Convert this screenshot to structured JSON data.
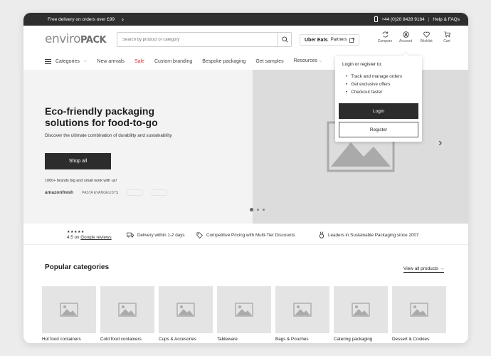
{
  "topbar": {
    "promo": "Free delivery on orders over £99",
    "promo_arrow": "›",
    "phone": "+44 (0)20 8428 9184",
    "separator": "|",
    "help": "Help & FAQs"
  },
  "header": {
    "logo_light": "enviro",
    "logo_bold": "PACK",
    "search_placeholder": "Search by product or category",
    "partner_brand": "Uber Eats",
    "partner_label": "Partners",
    "icons": [
      {
        "name": "compare-icon",
        "label": "Compare"
      },
      {
        "name": "account-icon",
        "label": "Account"
      },
      {
        "name": "wishlist-icon",
        "label": "Wishlist"
      },
      {
        "name": "cart-icon",
        "label": "Cart"
      }
    ]
  },
  "nav": {
    "categories": "Categories",
    "items": [
      "New arrivals",
      "Sale",
      "Custom branding",
      "Bespoke packaging",
      "Get samples",
      "Resources"
    ],
    "chevron": "⌵",
    "sale_color": "#dd3333"
  },
  "hero": {
    "title": "Eco-friendly packaging solutions for food-to-go",
    "subtitle": "Discover the ultimate combination of durability and sustainability",
    "cta": "Shop all",
    "brands_label": "1000+ brands big and small work with us!",
    "brands": [
      "amazonfresh",
      "PASTA EVANGELISTS"
    ],
    "next_arrow": "›"
  },
  "trust": {
    "stars": "★★★★★",
    "rating_prefix": "4.5 on",
    "rating_link": "Google reviews",
    "delivery": "Delivery within 1-2 days",
    "pricing": "Competitive Pricing with Multi-Tier Discounts",
    "leaders": "Leaders in Sustainable Packaging since 2007"
  },
  "popular": {
    "title": "Popular categories",
    "view_all": "View all products →",
    "categories": [
      "Hot food containers",
      "Cold food containers",
      "Cups & Accesories",
      "Tableware",
      "Bags & Pouches",
      "Catering packaging",
      "Dessert & Cookies"
    ]
  },
  "account_dropdown": {
    "title": "Login or register to:",
    "benefits": [
      "Track and manage orders",
      "Get exclusive offers",
      "Checkout faster"
    ],
    "login": "Login",
    "register": "Register"
  }
}
